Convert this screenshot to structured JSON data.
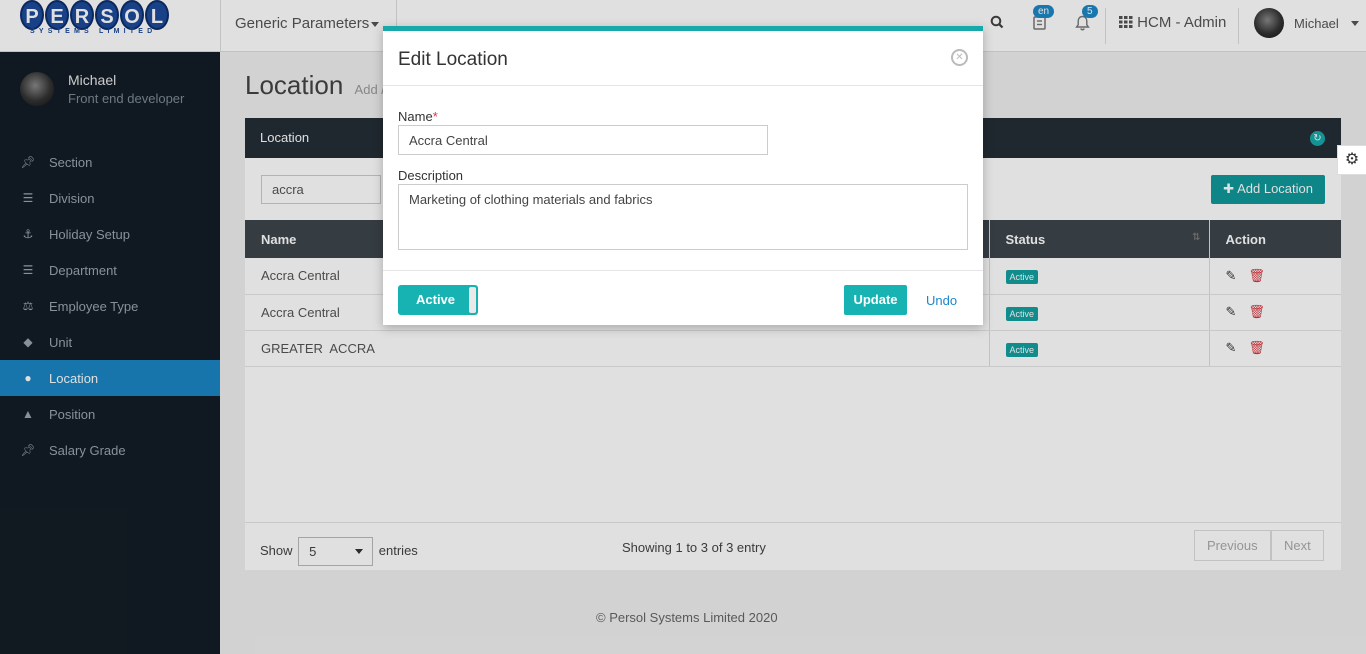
{
  "topbar": {
    "logo_letters": [
      "P",
      "E",
      "R",
      "S",
      "O",
      "L"
    ],
    "logo_subtitle": "SYSTEMS LIMITED",
    "menu_label": "Generic Parameters",
    "lang_badge": "en",
    "notif_count": "5",
    "app_name": "HCM - Admin",
    "user_name": "Michael"
  },
  "sidebar": {
    "user_name": "Michael",
    "user_role": "Front end developer",
    "items": [
      {
        "label": "Section",
        "icon": "pin-icon"
      },
      {
        "label": "Division",
        "icon": "document-icon"
      },
      {
        "label": "Holiday Setup",
        "icon": "person-icon"
      },
      {
        "label": "Department",
        "icon": "document-icon"
      },
      {
        "label": "Employee Type",
        "icon": "scale-icon"
      },
      {
        "label": "Unit",
        "icon": "tag-icon"
      },
      {
        "label": "Location",
        "icon": "map-pin-icon"
      },
      {
        "label": "Position",
        "icon": "graduation-cap-icon"
      },
      {
        "label": "Salary Grade",
        "icon": "pin-icon"
      }
    ]
  },
  "page": {
    "title": "Location",
    "crumb": "Add /"
  },
  "panel": {
    "title": "Location",
    "search_value": "accra",
    "add_button": "Add Location",
    "columns": {
      "name": "Name",
      "status": "Status",
      "action": "Action"
    },
    "rows": [
      {
        "name": "Accra Central",
        "status": "Active"
      },
      {
        "name": "Accra Central",
        "status": "Active"
      },
      {
        "name": "GREATER  ACCRA",
        "status": "Active"
      }
    ],
    "show_label": "Show",
    "entries_label": "entries",
    "page_size": "5",
    "info": "Showing 1 to 3 of 3 entry",
    "prev": "Previous",
    "next": "Next"
  },
  "footer": {
    "copyright": "© Persol Systems Limited 2020"
  },
  "modal": {
    "title": "Edit Location",
    "name_label": "Name",
    "required_mark": "*",
    "name_value": "Accra Central",
    "desc_label": "Description",
    "desc_value": "Marketing of clothing materials and fabrics",
    "toggle_label": "Active",
    "update": "Update",
    "undo": "Undo"
  },
  "colors": {
    "accent": "#17b3b3",
    "sidebar": "#131d26",
    "active_item": "#1c86c3",
    "panel_head": "#252e36",
    "danger": "#d9363e"
  }
}
